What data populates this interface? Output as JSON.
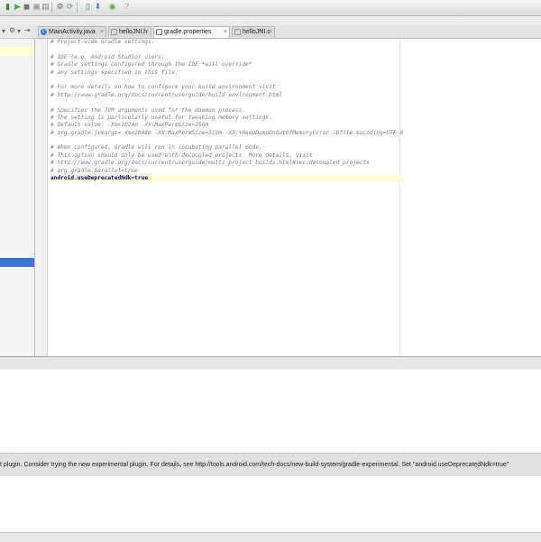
{
  "tabs": [
    {
      "label": "MainActivity.java",
      "active": false
    },
    {
      "label": "helloJNI.h",
      "active": false
    },
    {
      "label": "gradle.properties",
      "active": true
    },
    {
      "label": "helloJNI.c",
      "active": false
    }
  ],
  "editor": {
    "lines": [
      "# Project-wide Gradle settings.",
      "",
      "# IDE (e.g. Android Studio) users:",
      "# Gradle settings configured through the IDE *will override*",
      "# any settings specified in this file.",
      "",
      "# For more details on how to configure your build environment visit",
      "# http://www.gradle.org/docs/current/userguide/build_environment.html",
      "",
      "# Specifies the JVM arguments used for the daemon process.",
      "# The setting is particularly useful for tweaking memory settings.",
      "# Default value: -Xmx1024m -XX:MaxPermSize=256m",
      "# org.gradle.jvmargs=-Xmx2048m -XX:MaxPermSize=512m -XX:+HeapDumpOnOutOfMemoryError -Dfile.encoding=UTF-8",
      "",
      "# When configured, Gradle will run in incubating parallel mode.",
      "# This option should only be used with decoupled projects. More details, visit",
      "# http://www.gradle.org/docs/current/userguide/multi_project_builds.html#sec:decoupled_projects",
      "# org.gradle.parallel=true"
    ],
    "last_line_key": "android.useDeprecatedNdk",
    "last_line_sep": "=",
    "last_line_value": "true"
  },
  "message": "t plugin.  Consider trying the new experimental plugin.  For details, see http://tools.android.com/tech-docs/new-build-system/gradle-experimental.  Set \"android.useDeprecatedNdk=true\"",
  "colors": {
    "accent": "#3875d7",
    "comment": "#808080",
    "keyword": "#000080",
    "run": "#4caf50"
  }
}
